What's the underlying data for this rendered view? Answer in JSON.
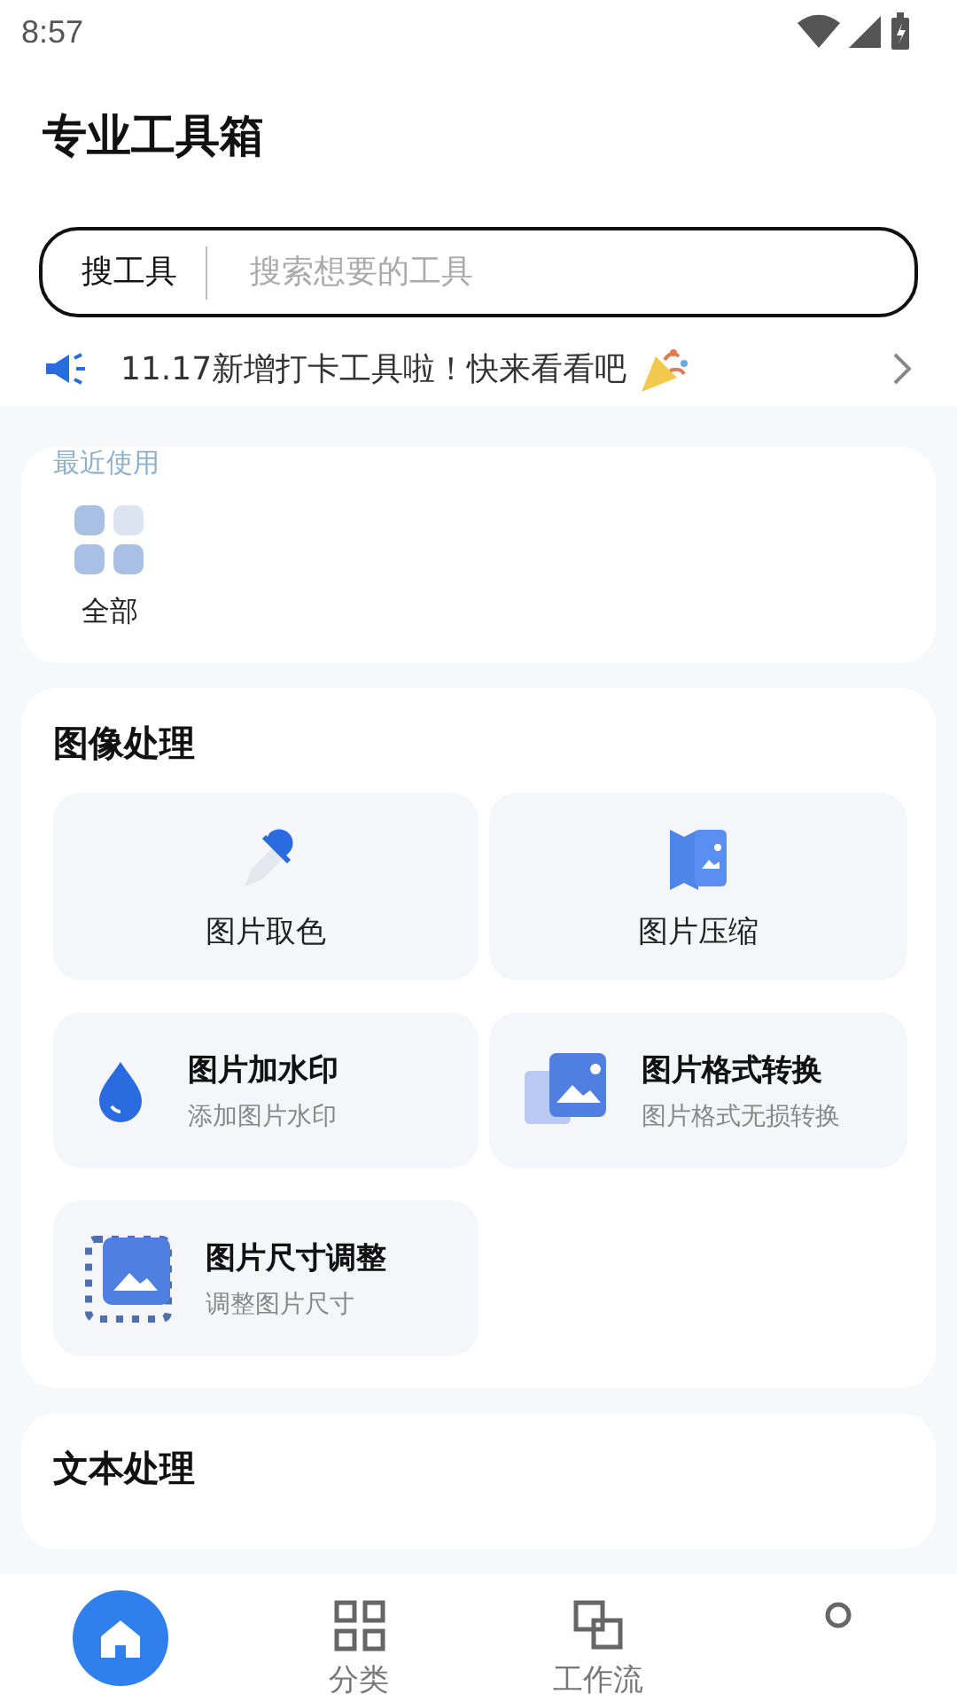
{
  "status_bar": {
    "time": "8:57"
  },
  "title": "专业工具箱",
  "search": {
    "label": "搜工具",
    "placeholder": "搜索想要的工具"
  },
  "notice": {
    "text": "11.17新增打卡工具啦！快来看看吧"
  },
  "recent": {
    "title": "最近使用",
    "items": [
      {
        "label": "全部"
      }
    ]
  },
  "sections": [
    {
      "title": "图像处理",
      "tools": [
        {
          "kind": "tile",
          "name": "图片取色"
        },
        {
          "kind": "tile",
          "name": "图片压缩"
        },
        {
          "kind": "row",
          "name": "图片加水印",
          "desc": "添加图片水印"
        },
        {
          "kind": "row",
          "name": "图片格式转换",
          "desc": "图片格式无损转换"
        },
        {
          "kind": "row",
          "name": "图片尺寸调整",
          "desc": "调整图片尺寸"
        }
      ]
    },
    {
      "title": "文本处理"
    }
  ],
  "nav": [
    {
      "selected": true
    },
    {
      "label": "分类",
      "selected": false
    },
    {
      "label": "工作流",
      "selected": false
    },
    {
      "selected": false
    }
  ]
}
